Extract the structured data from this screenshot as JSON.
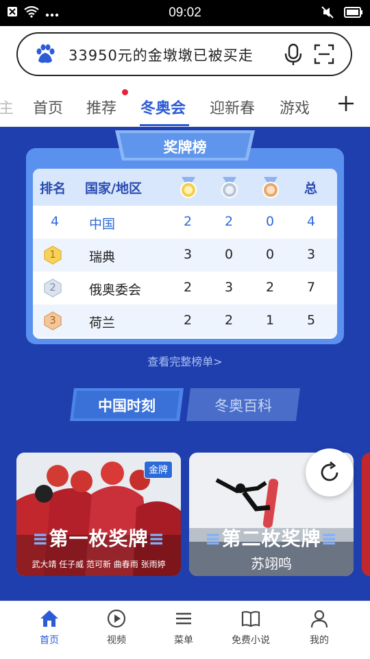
{
  "status": {
    "time": "09:02"
  },
  "search": {
    "text": "33950元的金墩墩已被买走"
  },
  "tabs": [
    {
      "label": "主"
    },
    {
      "label": "首页"
    },
    {
      "label": "推荐"
    },
    {
      "label": "冬奥会",
      "active": true
    },
    {
      "label": "迎新春"
    },
    {
      "label": "游戏"
    }
  ],
  "medals": {
    "title": "奖牌榜",
    "headers": {
      "rank": "排名",
      "country": "国家/地区",
      "total": "总"
    },
    "rows": [
      {
        "rank": "4",
        "country": "中国",
        "gold": "2",
        "silver": "2",
        "bronze": "0",
        "total": "4"
      },
      {
        "rank": "1",
        "country": "瑞典",
        "gold": "3",
        "silver": "0",
        "bronze": "0",
        "total": "3"
      },
      {
        "rank": "2",
        "country": "俄奥委会",
        "gold": "2",
        "silver": "3",
        "bronze": "2",
        "total": "7"
      },
      {
        "rank": "3",
        "country": "荷兰",
        "gold": "2",
        "silver": "2",
        "bronze": "1",
        "total": "5"
      }
    ],
    "view_all": "查看完整榜单>"
  },
  "segments": [
    {
      "label": "中国时刻",
      "active": true
    },
    {
      "label": "冬奥百科",
      "active": false
    }
  ],
  "cards": [
    {
      "title": "第一枚奖牌",
      "subtitle": "武大靖 任子威 范可新 曲春雨 张雨婷",
      "badge": "金牌"
    },
    {
      "title": "第二枚奖牌",
      "subtitle": "苏翊鸣"
    }
  ],
  "bottom_nav": [
    {
      "label": "首页",
      "icon": "home-icon",
      "active": true
    },
    {
      "label": "视频",
      "icon": "play-circle-icon"
    },
    {
      "label": "菜单",
      "icon": "menu-icon"
    },
    {
      "label": "免费小说",
      "icon": "book-icon"
    },
    {
      "label": "我的",
      "icon": "user-icon"
    }
  ],
  "colors": {
    "accent": "#2c5bd6",
    "page_bg": "#1f3fae",
    "red_dot": "#e5243b"
  }
}
